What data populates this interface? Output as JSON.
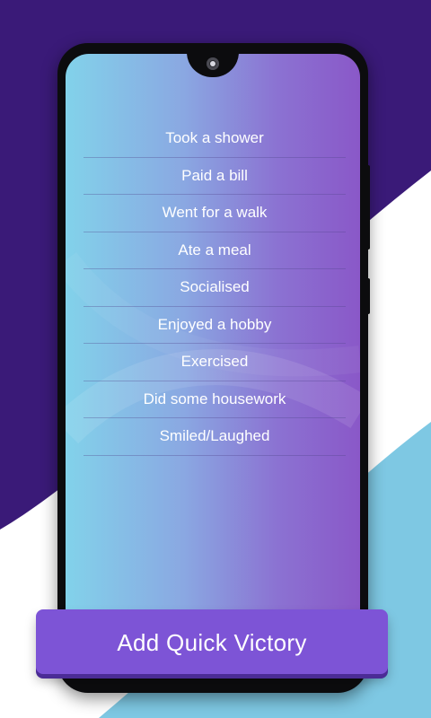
{
  "colors": {
    "background_dark": "#3a1a78",
    "background_light": "#ffffff",
    "background_wave": "#7ec8e3",
    "screen_gradient_start": "#82d2ea",
    "screen_gradient_end": "#8a58c8",
    "button": "#7d54d6",
    "text": "#ffffff"
  },
  "quick_victories": {
    "items": [
      {
        "label": "Took a shower"
      },
      {
        "label": "Paid a bill"
      },
      {
        "label": "Went for a walk"
      },
      {
        "label": "Ate a meal"
      },
      {
        "label": "Socialised"
      },
      {
        "label": "Enjoyed a hobby"
      },
      {
        "label": "Exercised"
      },
      {
        "label": "Did some housework"
      },
      {
        "label": "Smiled/Laughed"
      }
    ]
  },
  "actions": {
    "add_label": "Add Quick Victory"
  }
}
